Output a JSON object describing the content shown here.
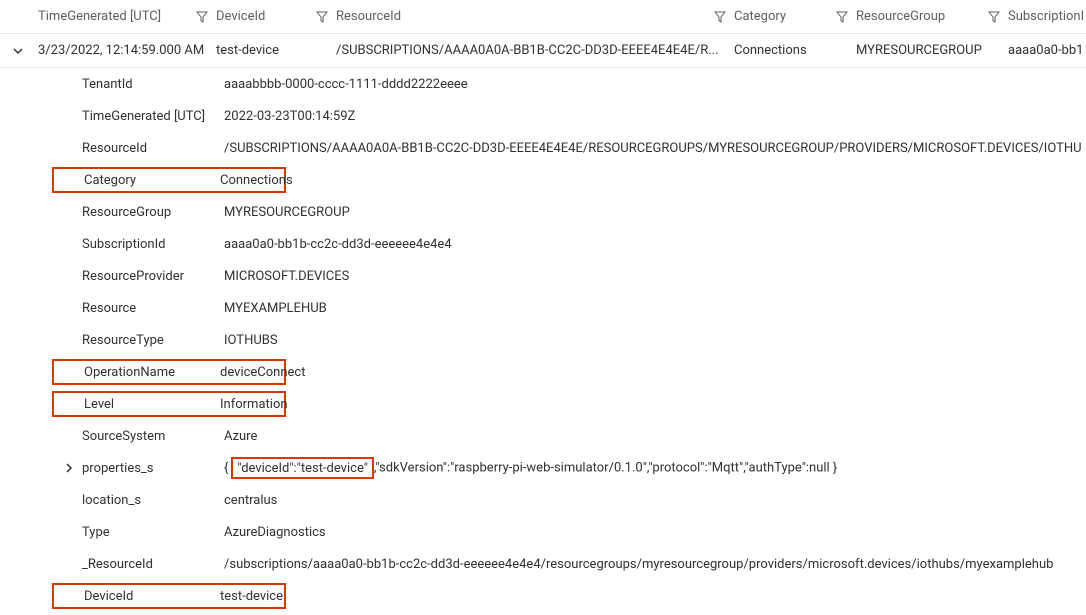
{
  "header": {
    "timeGenerated": "TimeGenerated [UTC]",
    "deviceId": "DeviceId",
    "resourceId": "ResourceId",
    "category": "Category",
    "resourceGroup": "ResourceGroup",
    "subscriptionId": "SubscriptionI"
  },
  "row": {
    "time": "3/23/2022, 12:14:59.000 AM",
    "deviceId": "test-device",
    "resourceId": "/SUBSCRIPTIONS/AAAA0A0A-BB1B-CC2C-DD3D-EEEE4E4E4E/R...",
    "category": "Connections",
    "resourceGroup": "MYRESOURCEGROUP",
    "subscriptionId": "aaaa0a0-bb1"
  },
  "details": {
    "TenantId": {
      "label": "TenantId",
      "value": "aaaabbbb-0000-cccc-1111-dddd2222eeee"
    },
    "TimeGenerated": {
      "label": "TimeGenerated [UTC]",
      "value": "2022-03-23T00:14:59Z"
    },
    "ResourceId": {
      "label": "ResourceId",
      "value": "/SUBSCRIPTIONS/AAAA0A0A-BB1B-CC2C-DD3D-EEEE4E4E4E/RESOURCEGROUPS/MYRESOURCEGROUP/PROVIDERS/MICROSOFT.DEVICES/IOTHU"
    },
    "Category": {
      "label": "Category",
      "value": "Connections"
    },
    "ResourceGroup": {
      "label": "ResourceGroup",
      "value": "MYRESOURCEGROUP"
    },
    "SubscriptionId": {
      "label": "SubscriptionId",
      "value": "aaaa0a0-bb1b-cc2c-dd3d-eeeeee4e4e4"
    },
    "ResourceProvider": {
      "label": "ResourceProvider",
      "value": "MICROSOFT.DEVICES"
    },
    "Resource": {
      "label": "Resource",
      "value": "MYEXAMPLEHUB"
    },
    "ResourceType": {
      "label": "ResourceType",
      "value": "IOTHUBS"
    },
    "OperationName": {
      "label": "OperationName",
      "value": "deviceConnect"
    },
    "Level": {
      "label": "Level",
      "value": "Information"
    },
    "SourceSystem": {
      "label": "SourceSystem",
      "value": "Azure"
    },
    "properties_s": {
      "label": "properties_s",
      "value_prefix": "{",
      "value_hl": "\"deviceId\":\"test-device\"",
      "value_suffix": ",\"sdkVersion\":\"raspberry-pi-web-simulator/0.1.0\",\"protocol\":\"Mqtt\",\"authType\":null }"
    },
    "location_s": {
      "label": "location_s",
      "value": "centralus"
    },
    "Type": {
      "label": "Type",
      "value": "AzureDiagnostics"
    },
    "_ResourceId": {
      "label": "_ResourceId",
      "value": "/subscriptions/aaaa0a0-bb1b-cc2c-dd3d-eeeeee4e4e4/resourcegroups/myresourcegroup/providers/microsoft.devices/iothubs/myexamplehub"
    },
    "DeviceId": {
      "label": "DeviceId",
      "value": "test-device"
    }
  }
}
